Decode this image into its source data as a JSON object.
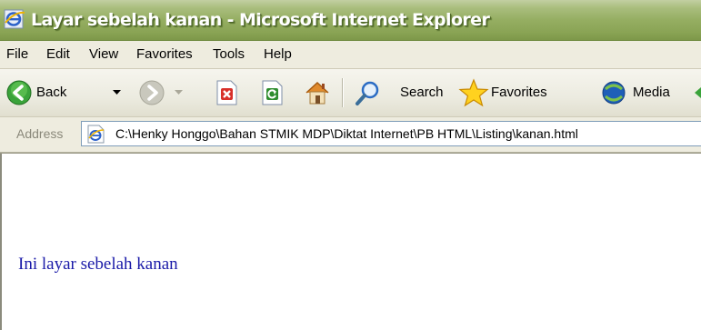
{
  "window": {
    "title": "Layar sebelah kanan - Microsoft Internet Explorer"
  },
  "menu": {
    "items": [
      "File",
      "Edit",
      "View",
      "Favorites",
      "Tools",
      "Help"
    ]
  },
  "toolbar": {
    "back_label": "Back",
    "search_label": "Search",
    "favorites_label": "Favorites",
    "media_label": "Media"
  },
  "address": {
    "label": "Address",
    "value": "C:\\Henky Honggo\\Bahan STMIK MDP\\Diktat Internet\\PB HTML\\Listing\\kanan.html"
  },
  "content": {
    "text": "Ini layar sebelah kanan"
  },
  "colors": {
    "titlebar": "#95ae62",
    "content_text": "#1a1aa8"
  }
}
